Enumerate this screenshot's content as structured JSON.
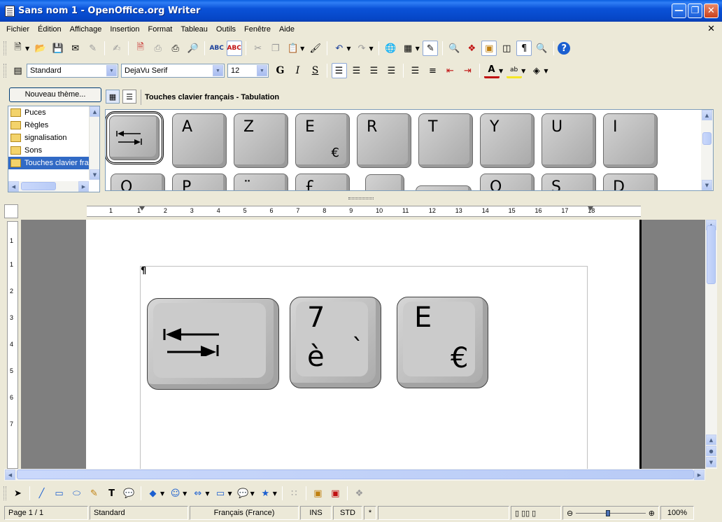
{
  "window": {
    "title": "Sans nom 1 - OpenOffice.org Writer"
  },
  "menu": [
    "Fichier",
    "Édition",
    "Affichage",
    "Insertion",
    "Format",
    "Tableau",
    "Outils",
    "Fenêtre",
    "Aide"
  ],
  "format_bar": {
    "style": "Standard",
    "font": "DejaVu Serif",
    "size": "12",
    "bold": "G",
    "italic": "I",
    "underline": "S"
  },
  "gallery": {
    "new_theme_label": "Nouveau thème...",
    "themes": [
      "Puces",
      "Règles",
      "signalisation",
      "Sons",
      "Touches clavier fra"
    ],
    "selected_theme": "Touches clavier fra",
    "title": "Touches clavier français - Tabulation",
    "row1": [
      {
        "label": "",
        "sub": ""
      },
      {
        "label": "A",
        "sub": ""
      },
      {
        "label": "Z",
        "sub": ""
      },
      {
        "label": "E",
        "sub": "€"
      },
      {
        "label": "R",
        "sub": ""
      },
      {
        "label": "T",
        "sub": ""
      },
      {
        "label": "Y",
        "sub": ""
      },
      {
        "label": "U",
        "sub": ""
      },
      {
        "label": "I",
        "sub": ""
      }
    ],
    "row2": [
      "O",
      "P",
      "¨",
      "£",
      "",
      "",
      "Q",
      "S",
      "D"
    ]
  },
  "ruler": [
    "1",
    "1",
    "2",
    "3",
    "4",
    "5",
    "6",
    "7",
    "8",
    "9",
    "10",
    "11",
    "12",
    "13",
    "14",
    "15",
    "16",
    "17",
    "18"
  ],
  "vruler": [
    "1",
    "1",
    "2",
    "3",
    "4",
    "5",
    "6",
    "7"
  ],
  "document": {
    "pilcrow": "¶",
    "key_tab": "tab-key",
    "key_7": {
      "top": "7",
      "bottom": "è",
      "accent": "`"
    },
    "key_e": {
      "top": "E",
      "bottom": "€"
    }
  },
  "status": {
    "page": "Page 1 / 1",
    "style": "Standard",
    "language": "Français (France)",
    "insert": "INS",
    "selection": "STD",
    "modified": "*",
    "zoom": "100%"
  }
}
